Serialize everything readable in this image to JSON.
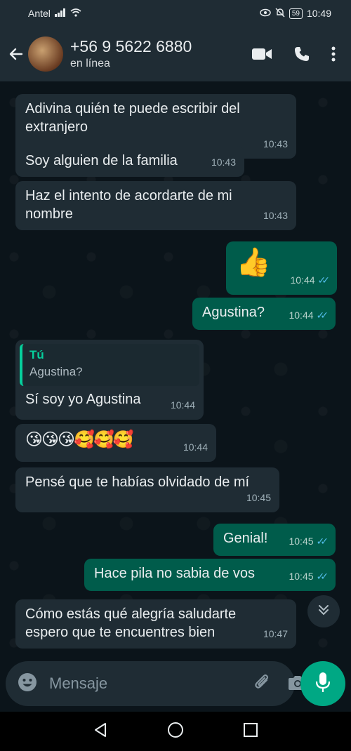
{
  "status_bar": {
    "carrier": "Antel",
    "battery": "59",
    "time": "10:49"
  },
  "header": {
    "contact_name": "+56 9 5622 6880",
    "contact_status": "en línea"
  },
  "messages": [
    {
      "text": "Adivina quién te puede escribir del extranjero",
      "time": "10:43"
    },
    {
      "text": "Soy alguien de la familia",
      "time": "10:43"
    },
    {
      "text": "Haz el intento de acordarte de mi nombre",
      "time": "10:43"
    },
    {
      "text": "👍",
      "time": "10:44"
    },
    {
      "text": "Agustina?",
      "time": "10:44"
    },
    {
      "quote_author": "Tú",
      "quote_text": "Agustina?",
      "text": "Sí soy yo Agustina",
      "time": "10:44"
    },
    {
      "text": "😘😘😘🥰🥰🥰",
      "time": "10:44"
    },
    {
      "text": "Pensé que te habías olvidado de mí",
      "time": "10:45"
    },
    {
      "text": "Genial!",
      "time": "10:45"
    },
    {
      "text": "Hace pila no sabia de vos",
      "time": "10:45"
    },
    {
      "text": "Cómo estás qué alegría saludarte espero que te encuentres bien",
      "time": "10:47"
    }
  ],
  "input": {
    "placeholder": "Mensaje"
  },
  "colors": {
    "accent": "#00a884",
    "incoming_bubble": "#1f2c34",
    "outgoing_bubble": "#005c4b",
    "read_ticks": "#53bdeb"
  }
}
